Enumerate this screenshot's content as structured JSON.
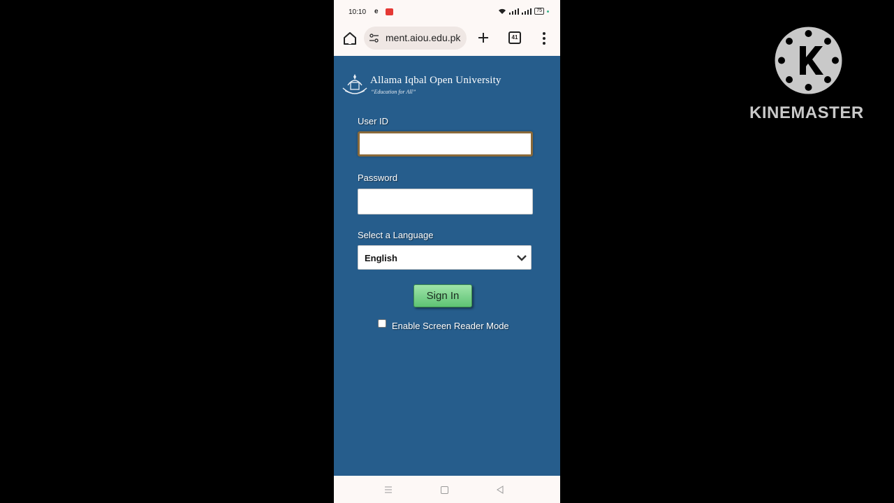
{
  "status_bar": {
    "time": "10:10",
    "battery": "75"
  },
  "browser": {
    "url": "ment.aiou.edu.pk",
    "tab_count": "41"
  },
  "login": {
    "university_name": "Allama Iqbal Open University",
    "tagline": "“Education for All”",
    "user_id_label": "User ID",
    "user_id_value": "",
    "password_label": "Password",
    "password_value": "",
    "language_label": "Select a Language",
    "language_selected": "English",
    "signin_label": "Sign In",
    "screen_reader_label": "Enable Screen Reader Mode",
    "screen_reader_checked": false
  },
  "watermark": {
    "text": "KINEMASTER"
  },
  "colors": {
    "page_background": "#265d8c",
    "signin_button": "#5ec374",
    "focus_border": "#8a6a3a"
  },
  "icons": [
    "home-icon",
    "site-info-icon",
    "new-tab-icon",
    "tab-switcher-icon",
    "more-menu-icon",
    "university-emblem",
    "chevron-down-icon",
    "nav-recents-icon",
    "nav-home-icon",
    "nav-back-icon",
    "kinemaster-logo"
  ]
}
